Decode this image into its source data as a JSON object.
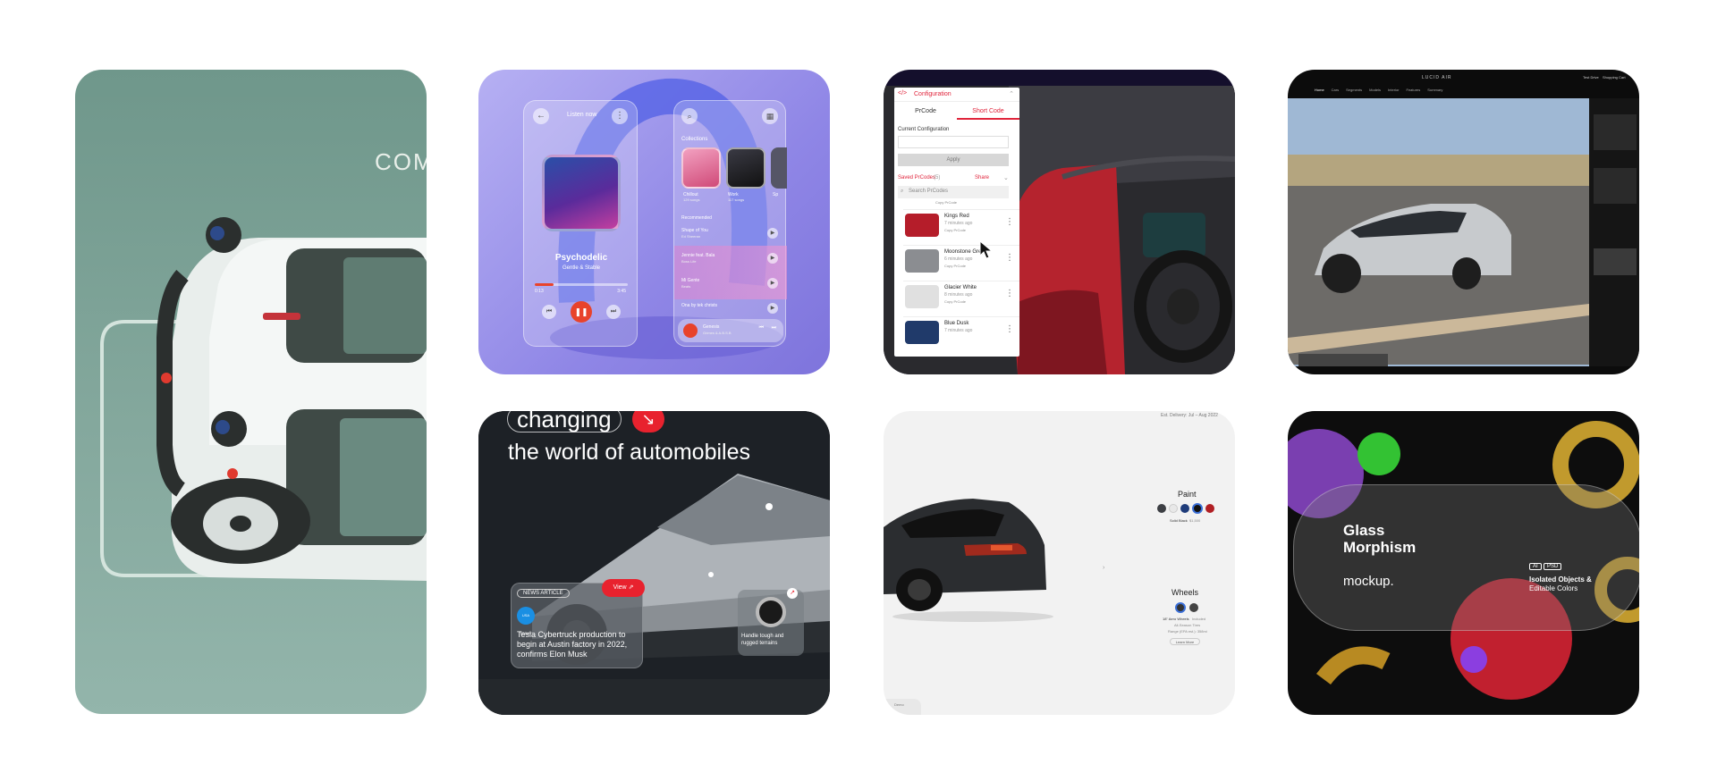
{
  "cards": {
    "vehicle": {
      "word": "COMI"
    },
    "music": {
      "top_label": "Listen now",
      "track_title": "Psychodelic",
      "track_artist": "Gentle & Stable",
      "time_left": "0:13",
      "time_right": "3:45",
      "collections_label": "Collections",
      "collections": [
        {
          "name": "Chillout",
          "count": "129 songs"
        },
        {
          "name": "Work",
          "count": "117 songs"
        },
        {
          "name": "Sp",
          "count": ""
        }
      ],
      "recommended_label": "Recommended",
      "songs": [
        {
          "title": "Shape of You",
          "artist": "Ed Sheeran"
        },
        {
          "title": "Jennie feat. Bala",
          "artist": "Boss Life"
        },
        {
          "title": "Mi Gente",
          "artist": "Beats"
        },
        {
          "title": "Ona by tek christs",
          "artist": ""
        }
      ],
      "now_playing": {
        "title": "Genesis",
        "artist": "Grimes & A.B.S.B"
      }
    },
    "config": {
      "panel_title": "Configuration",
      "tabs": [
        "PrCode",
        "Short Code"
      ],
      "current_label": "Current Configuration",
      "apply_label": "Apply",
      "saved_label": "Saved PrCodes",
      "saved_count": "(5)",
      "share_label": "Share",
      "search_placeholder": "Search PrCodes",
      "items": [
        {
          "name": "Kings Red",
          "time": "7 minutes ago",
          "meta": "Copy PrCode",
          "color": "#b51d2a"
        },
        {
          "name": "Moonstone Grey",
          "time": "6 minutes ago",
          "meta": "Copy PrCode",
          "color": "#8b8d91"
        },
        {
          "name": "Glacier White",
          "time": "8 minutes ago",
          "meta": "Copy PrCode",
          "color": "#e8e8e8"
        },
        {
          "name": "Blue Dusk",
          "time": "7 minutes ago",
          "meta": "",
          "color": "#203a6a"
        }
      ],
      "partial_meta": "Copy PrCode"
    },
    "lucid": {
      "brand": "LUCID AIR",
      "right_links": [
        "Test Drive",
        "Shopping Cart"
      ],
      "nav": [
        "Home",
        "Cars",
        "Segments",
        "Models",
        "Interior",
        "Features",
        "Summary"
      ]
    },
    "cybertruck": {
      "headline_1": "changing",
      "headline_2": "the world of automobiles",
      "tag": "NEWS ARTICLE",
      "view_label": "View",
      "source_logo": "USA TODAY",
      "article": "Tesla Cybertruck production to begin at Austin factory in 2022, confirms Elon Musk",
      "handle": "Handle tough and rugged terrains"
    },
    "tesla": {
      "top_meta": "Est. Delivery: Jul – Aug 2022",
      "paint_label": "Paint",
      "paint_colors": [
        "#3d3f44",
        "#e8e8e8",
        "#1f3c7a",
        "#111111",
        "#b11f24"
      ],
      "paint_caption": "Solid Black",
      "paint_price": "$1,500",
      "wheels_label": "Wheels",
      "wheels_caption": "18\" Aero Wheels",
      "wheels_price": "Included",
      "wheels_line2": "All-Season Tires",
      "wheels_line3": "Range (EPA est.): 358mi",
      "learn_more": "Learn More",
      "footer": "Demo"
    },
    "glass": {
      "title_1": "Glass",
      "title_2": "Morphism",
      "subtitle": "mockup.",
      "badge_1": "AI",
      "badge_2": "PSD",
      "feature_1": "Isolated Objects &",
      "feature_2": "Editable Colors"
    }
  },
  "colors": {
    "config_accent": "#e0243b",
    "cybertruck_accent": "#e8222e",
    "music_pause": "#e8432b"
  }
}
